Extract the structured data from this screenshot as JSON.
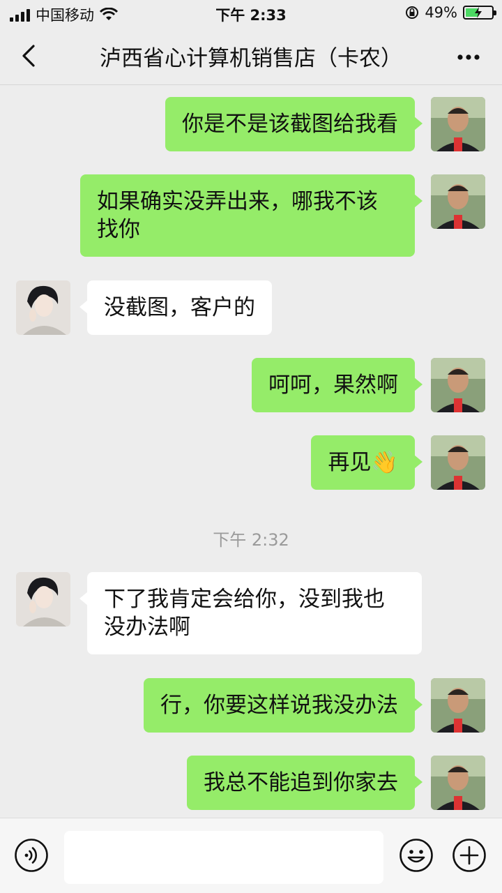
{
  "status_bar": {
    "carrier": "中国移动",
    "time": "下午 2:33",
    "battery": "49%",
    "battery_level": 0.49
  },
  "nav": {
    "title": "泸西省心计算机销售店（卡农）"
  },
  "messages": [
    {
      "side": "me",
      "text": "你是不是该截图给我看"
    },
    {
      "side": "me",
      "text": "如果确实没弄出来，哪我不该找你"
    },
    {
      "side": "other",
      "text": "没截图，客户的"
    },
    {
      "side": "me",
      "text": "呵呵，果然啊"
    },
    {
      "side": "me",
      "text": "再见",
      "emoji": "👋"
    },
    {
      "side": "other",
      "text": "下了我肯定会给你，没到我也没办法啊"
    },
    {
      "side": "me",
      "text": "行，你要这样说我没办法"
    },
    {
      "side": "me",
      "text": "我总不能追到你家去"
    }
  ],
  "timestamp": "下午 2:32",
  "input_bar": {
    "icons": [
      "voice-icon",
      "emoji-icon",
      "plus-icon"
    ]
  }
}
